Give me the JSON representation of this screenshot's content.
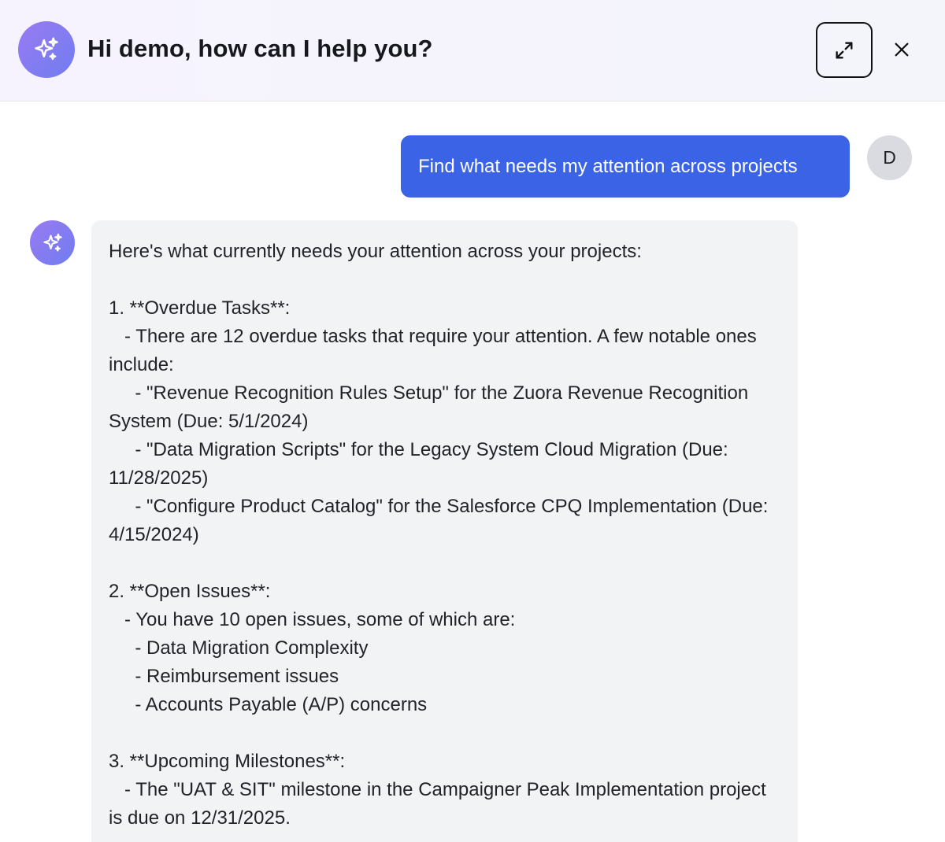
{
  "header": {
    "title": "Hi demo, how can I help you?",
    "logo_icon": "sparkle-icon",
    "expand_icon": "expand-icon",
    "close_icon": "close-icon"
  },
  "colors": {
    "accent": "#3b63e6",
    "logo_gradient_start": "#9a7af2",
    "logo_gradient_end": "#6f7df0",
    "bot_bubble": "#f2f3f5",
    "user_avatar": "#d9dbe0"
  },
  "chat": {
    "user_message": "Find what needs my attention across projects",
    "user_avatar_initial": "D",
    "bot_avatar_icon": "sparkle-icon",
    "bot_message": "Here's what currently needs your attention across your projects:\n\n1. **Overdue Tasks**:\n   - There are 12 overdue tasks that require your attention. A few notable ones include:\n     - \"Revenue Recognition Rules Setup\" for the Zuora Revenue Recognition System (Due: 5/1/2024)\n     - \"Data Migration Scripts\" for the Legacy System Cloud Migration (Due: 11/28/2025)\n     - \"Configure Product Catalog\" for the Salesforce CPQ Implementation (Due: 4/15/2024)\n\n2. **Open Issues**:\n   - You have 10 open issues, some of which are:\n     - Data Migration Complexity\n     - Reimbursement issues\n     - Accounts Payable (A/P) concerns\n\n3. **Upcoming Milestones**:\n   - The \"UAT & SIT\" milestone in the Campaigner Peak Implementation project is due on 12/31/2025."
  }
}
